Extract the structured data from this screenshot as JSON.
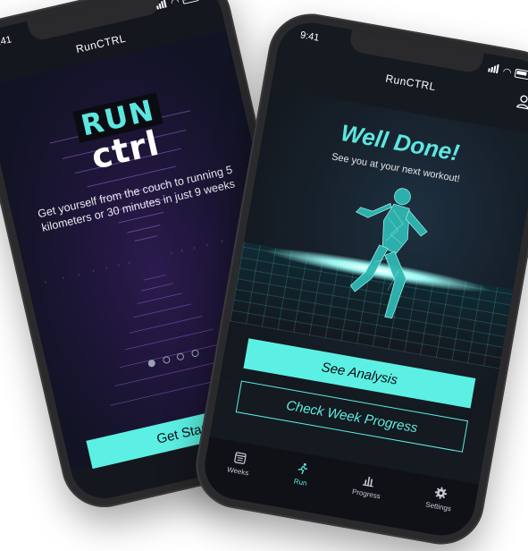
{
  "status_time": "9:41",
  "app_title": "RunCTRL",
  "intro_screen": {
    "logo_top": "RUN",
    "logo_bottom": "ctrl",
    "intro_text": "Get yourself from the couch to running 5 kilometers or 30 minutes in just 9 weeks",
    "pager": {
      "count": 4,
      "active_index": 0
    },
    "cta_label": "Get Started"
  },
  "done_screen": {
    "heading": "Well Done!",
    "subtitle": "See you at your next workout!",
    "primary_button": "See Analysis",
    "secondary_button": "Check Week Progress"
  },
  "tabbar": {
    "items": [
      {
        "label": "Weeks",
        "icon": "calendar-icon",
        "active": false
      },
      {
        "label": "Run",
        "icon": "runner-icon",
        "active": true
      },
      {
        "label": "Progress",
        "icon": "bar-chart-icon",
        "active": false
      },
      {
        "label": "Settings",
        "icon": "gear-icon",
        "active": false
      }
    ]
  },
  "colors": {
    "accent": "#5CF0E4",
    "screen_bg": "#14171D",
    "phone_body": "#2A2A2C"
  }
}
